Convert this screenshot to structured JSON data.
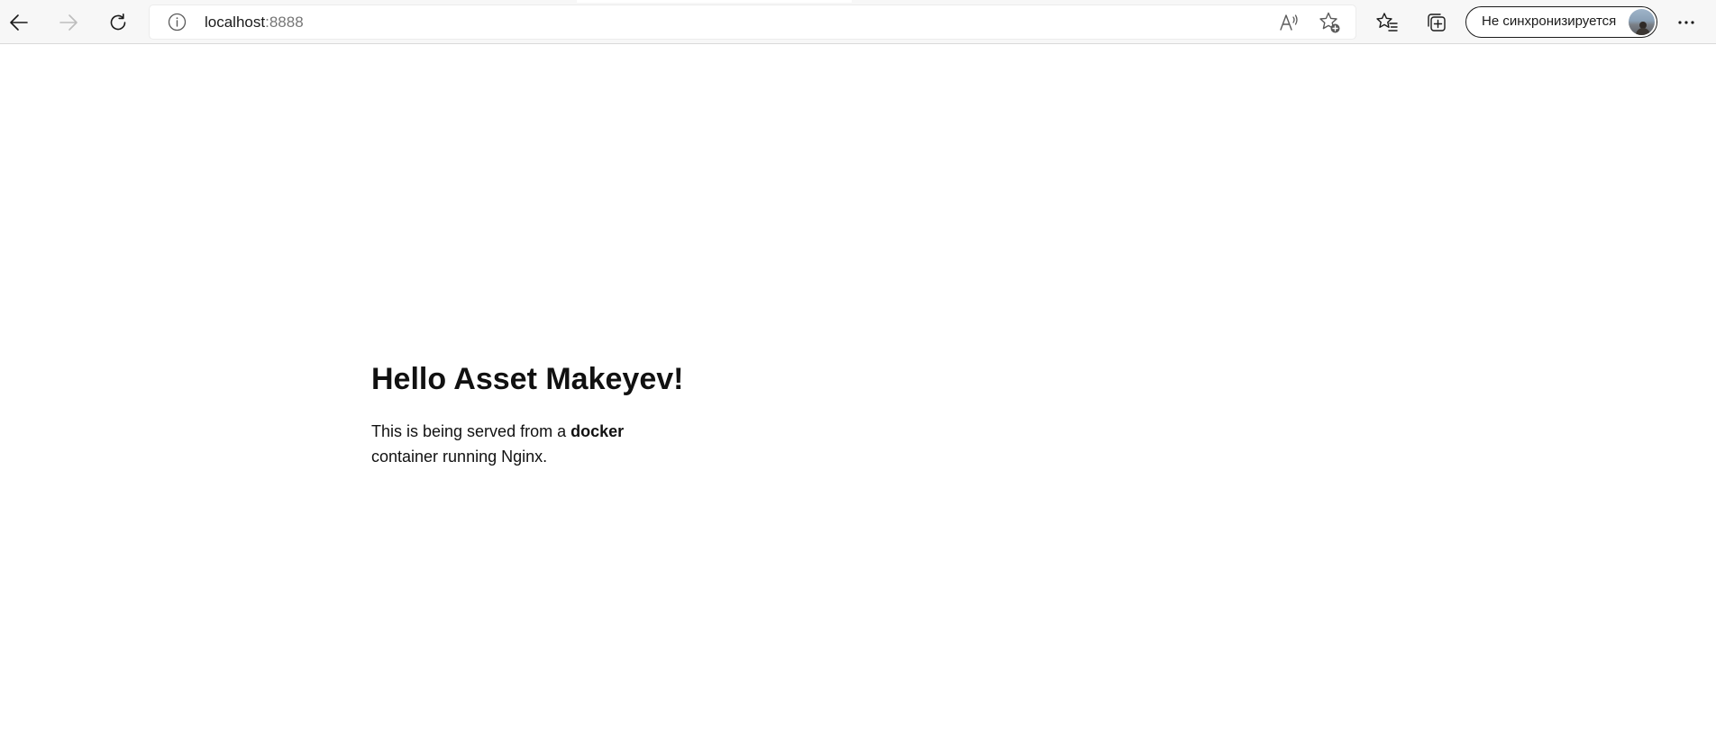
{
  "browser": {
    "url": {
      "host": "localhost",
      "port": ":8888"
    },
    "profile": {
      "label": "Не синхронизируется"
    },
    "icons": {
      "back": "back-arrow-icon",
      "forward": "forward-arrow-icon",
      "refresh": "refresh-icon",
      "info": "info-icon",
      "read_aloud": "read-aloud-icon",
      "add_favorite": "add-favorite-star-icon",
      "favorites": "favorites-list-icon",
      "collections": "collections-icon",
      "more": "more-dots-icon"
    },
    "colors": {
      "toolbar_bg": "#f7f7f7",
      "text": "#1a1a1a",
      "port_text": "#767676",
      "disabled_icon": "#bdbdbd"
    }
  },
  "page": {
    "heading": "Hello Asset Makeyev!",
    "paragraph": {
      "before": "This is being served from a ",
      "bold": "docker",
      "after": " container running Nginx."
    }
  }
}
